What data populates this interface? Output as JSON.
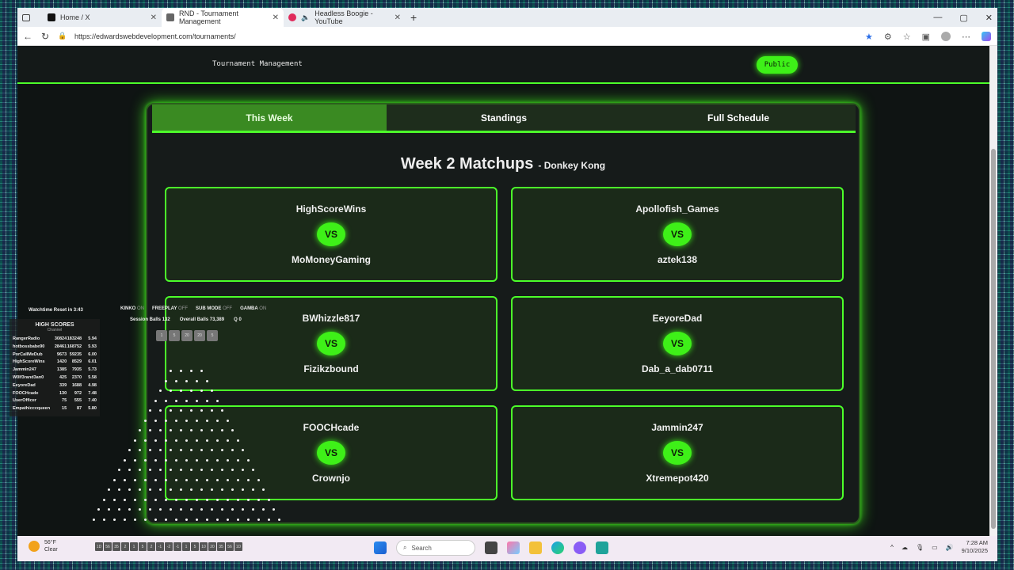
{
  "browser": {
    "tabs": [
      {
        "label": "Home / X",
        "icon": "x-logo-icon"
      },
      {
        "label": "RND - Tournament Management",
        "icon": "page-icon"
      },
      {
        "label": "Headless Boogie - YouTube",
        "icon": "youtube-icon"
      }
    ],
    "url": "https://edwardswebdevelopment.com/tournaments/"
  },
  "header": {
    "title": "Tournament Management",
    "public_label": "Public"
  },
  "tabs": [
    "This Week",
    "Standings",
    "Full Schedule"
  ],
  "heading": {
    "title": "Week 2 Matchups",
    "game": "- Donkey Kong"
  },
  "vs_label": "VS",
  "matchups": [
    {
      "p1": "HighScoreWins",
      "p2": "MoMoneyGaming"
    },
    {
      "p1": "Apollofish_Games",
      "p2": "aztek138"
    },
    {
      "p1": "BWhizzle817",
      "p2": "Fizikzbound"
    },
    {
      "p1": "EeyoreDad",
      "p2": "Dab_a_dab0711"
    },
    {
      "p1": "FOOCHcade",
      "p2": "Crownjo"
    },
    {
      "p1": "Jammin247",
      "p2": "Xtremepot420"
    }
  ],
  "overlay": {
    "reset": "Watchtime Reset in 3:43",
    "flags": [
      {
        "name": "KINKO",
        "state": "ON"
      },
      {
        "name": "FREEPLAY",
        "state": "OFF"
      },
      {
        "name": "SUB MODE",
        "state": "OFF"
      },
      {
        "name": "GAMBA",
        "state": "ON"
      }
    ],
    "session_label": "Session Balls",
    "session_value": "132",
    "overall_label": "Overall Balls",
    "overall_value": "73,389",
    "q_label": "Q",
    "q_value": "0",
    "buttons": [
      "1",
      "5",
      "20",
      "20",
      "5"
    ],
    "hs_title": "HIGH SCORES",
    "hs_sub": "Channel",
    "scores": [
      [
        "RangerRadio",
        "30824",
        "183248",
        "5.94"
      ],
      [
        "hotbossbabe90",
        "28461",
        "168752",
        "5.93"
      ],
      [
        "PorCallMeDub",
        "9673",
        "59235",
        "6.00"
      ],
      [
        "HighScoreWins",
        "1420",
        "8529",
        "6.01"
      ],
      [
        "Jammin247",
        "1385",
        "7935",
        "5.73"
      ],
      [
        "W0lf3rand3an0",
        "425",
        "2370",
        "5.58"
      ],
      [
        "EeyoreDad",
        "339",
        "1688",
        "4.98"
      ],
      [
        "FOOCHcade",
        "130",
        "972",
        "7.48"
      ],
      [
        "UserOfficer",
        "75",
        "555",
        "7.40"
      ],
      [
        "Empathicccqueen",
        "15",
        "87",
        "5.80"
      ]
    ]
  },
  "taskbar": {
    "temp": "56°F",
    "cond": "Clear",
    "search": "Search",
    "time": "7:28 AM",
    "date": "9/10/2025",
    "keys": [
      "1D",
      "56",
      "35",
      "2",
      "1",
      "5",
      "2",
      "-1",
      "-2",
      "-1",
      "1",
      "5",
      "10",
      "20",
      "35",
      "56",
      "1D"
    ]
  },
  "colors": {
    "accent": "#4cff2a",
    "panel": "#161b1a"
  }
}
